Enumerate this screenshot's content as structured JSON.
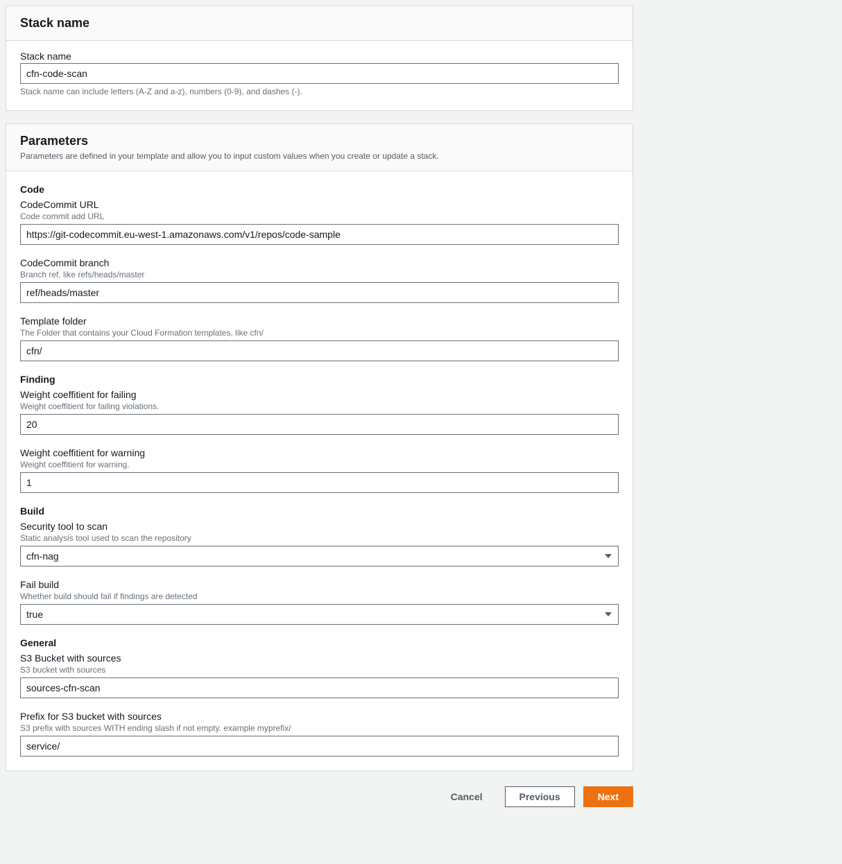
{
  "stackNamePanel": {
    "title": "Stack name",
    "label": "Stack name",
    "value": "cfn-code-scan",
    "hint": "Stack name can include letters (A-Z and a-z), numbers (0-9), and dashes (-)."
  },
  "parametersPanel": {
    "title": "Parameters",
    "subtitle": "Parameters are defined in your template and allow you to input custom values when you create or update a stack."
  },
  "sections": {
    "code": {
      "heading": "Code",
      "codecommitUrl": {
        "label": "CodeCommit URL",
        "hint": "Code commit add URL",
        "value": "https://git-codecommit.eu-west-1.amazonaws.com/v1/repos/code-sample"
      },
      "codecommitBranch": {
        "label": "CodeCommit branch",
        "hint": "Branch ref, like refs/heads/master",
        "value": "ref/heads/master"
      },
      "templateFolder": {
        "label": "Template folder",
        "hint": "The Folder that contains your Cloud Formation templates, like cfn/",
        "value": "cfn/"
      }
    },
    "finding": {
      "heading": "Finding",
      "weightFailing": {
        "label": "Weight coeffitient for failing",
        "hint": "Weight coeffitient for failing violations.",
        "value": "20"
      },
      "weightWarning": {
        "label": "Weight coeffitient for warning",
        "hint": "Weight coeffitient for warning.",
        "value": "1"
      }
    },
    "build": {
      "heading": "Build",
      "securityTool": {
        "label": "Security tool to scan",
        "hint": "Static analysis tool used to scan the repository",
        "value": "cfn-nag"
      },
      "failBuild": {
        "label": "Fail build",
        "hint": "Whether build should fail if findings are detected",
        "value": "true"
      }
    },
    "general": {
      "heading": "General",
      "s3Bucket": {
        "label": "S3 Bucket with sources",
        "hint": "S3 bucket with sources",
        "value": "sources-cfn-scan"
      },
      "s3Prefix": {
        "label": "Prefix for S3 bucket with sources",
        "hint": "S3 prefix with sources WITH ending slash if not empty. example myprefix/",
        "value": "service/"
      }
    }
  },
  "footer": {
    "cancel": "Cancel",
    "previous": "Previous",
    "next": "Next"
  }
}
